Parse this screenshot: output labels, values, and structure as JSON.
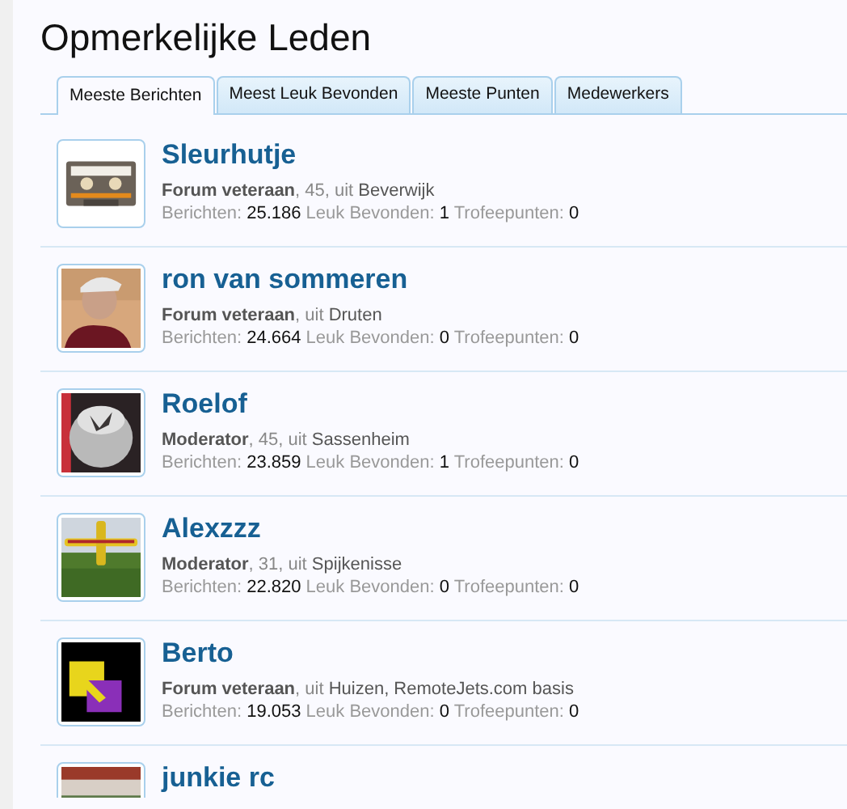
{
  "page_title": "Opmerkelijke Leden",
  "tabs": [
    {
      "label": "Meeste Berichten",
      "selected": true
    },
    {
      "label": "Meest Leuk Bevonden",
      "selected": false
    },
    {
      "label": "Meeste Punten",
      "selected": false
    },
    {
      "label": "Medewerkers",
      "selected": false
    }
  ],
  "members": [
    {
      "name": "Sleurhutje",
      "avatar": {
        "kind": "picture"
      },
      "details": [
        {
          "kind": "role",
          "text": "Forum veteraan"
        },
        {
          "kind": "muted",
          "text": ", 45, uit "
        },
        {
          "kind": "value",
          "text": "Beverwijk"
        }
      ],
      "stats": [
        {
          "kind": "label",
          "text": "Berichten: "
        },
        {
          "kind": "value",
          "text": "25.186"
        },
        {
          "kind": "label",
          "text": " Leuk Bevonden: "
        },
        {
          "kind": "value",
          "text": "1"
        },
        {
          "kind": "label",
          "text": " Trofeepunten: "
        },
        {
          "kind": "value",
          "text": "0"
        }
      ]
    },
    {
      "name": "ron van sommeren",
      "avatar": {
        "kind": "picture"
      },
      "details": [
        {
          "kind": "role",
          "text": "Forum veteraan"
        },
        {
          "kind": "muted",
          "text": ", uit "
        },
        {
          "kind": "value",
          "text": "Druten"
        }
      ],
      "stats": [
        {
          "kind": "label",
          "text": "Berichten: "
        },
        {
          "kind": "value",
          "text": "24.664"
        },
        {
          "kind": "label",
          "text": " Leuk Bevonden: "
        },
        {
          "kind": "value",
          "text": "0"
        },
        {
          "kind": "label",
          "text": " Trofeepunten: "
        },
        {
          "kind": "value",
          "text": "0"
        }
      ]
    },
    {
      "name": "Roelof",
      "avatar": {
        "kind": "picture"
      },
      "details": [
        {
          "kind": "role",
          "text": "Moderator"
        },
        {
          "kind": "muted",
          "text": ", 45, uit "
        },
        {
          "kind": "value",
          "text": "Sassenheim"
        }
      ],
      "stats": [
        {
          "kind": "label",
          "text": "Berichten: "
        },
        {
          "kind": "value",
          "text": "23.859"
        },
        {
          "kind": "label",
          "text": " Leuk Bevonden: "
        },
        {
          "kind": "value",
          "text": "1"
        },
        {
          "kind": "label",
          "text": " Trofeepunten: "
        },
        {
          "kind": "value",
          "text": "0"
        }
      ]
    },
    {
      "name": "Alexzzz",
      "avatar": {
        "kind": "picture"
      },
      "details": [
        {
          "kind": "role",
          "text": "Moderator"
        },
        {
          "kind": "muted",
          "text": ", 31, uit "
        },
        {
          "kind": "value",
          "text": "Spijkenisse"
        }
      ],
      "stats": [
        {
          "kind": "label",
          "text": "Berichten: "
        },
        {
          "kind": "value",
          "text": "22.820"
        },
        {
          "kind": "label",
          "text": " Leuk Bevonden: "
        },
        {
          "kind": "value",
          "text": "0"
        },
        {
          "kind": "label",
          "text": " Trofeepunten: "
        },
        {
          "kind": "value",
          "text": "0"
        }
      ]
    },
    {
      "name": "Berto",
      "avatar": {
        "kind": "picture"
      },
      "details": [
        {
          "kind": "role",
          "text": "Forum veteraan"
        },
        {
          "kind": "muted",
          "text": ", uit "
        },
        {
          "kind": "value",
          "text": "Huizen, RemoteJets.com basis"
        }
      ],
      "stats": [
        {
          "kind": "label",
          "text": "Berichten: "
        },
        {
          "kind": "value",
          "text": "19.053"
        },
        {
          "kind": "label",
          "text": " Leuk Bevonden: "
        },
        {
          "kind": "value",
          "text": "0"
        },
        {
          "kind": "label",
          "text": " Trofeepunten: "
        },
        {
          "kind": "value",
          "text": "0"
        }
      ]
    },
    {
      "name": "junkie rc",
      "avatar": {
        "kind": "picture"
      }
    }
  ]
}
